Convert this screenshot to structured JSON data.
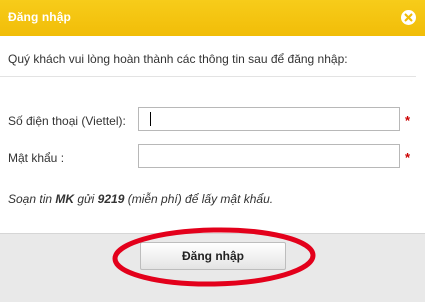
{
  "dialog": {
    "title": "Đăng nhập",
    "close_icon": "close-icon",
    "intro_text": "Quý khách vui lòng hoàn thành các thông tin sau để đăng nhập:",
    "fields": {
      "phone": {
        "label": "Số điện thoại (Viettel):",
        "value": "",
        "required_mark": "*"
      },
      "password": {
        "label": "Mật khẩu :",
        "value": "",
        "required_mark": "*"
      }
    },
    "hint": {
      "prefix": "Soạn tin ",
      "keyword": "MK",
      "middle": " gửi ",
      "number": "9219",
      "suffix": " (miễn phí) để lấy mật khẩu."
    },
    "submit_label": "Đăng nhập"
  },
  "colors": {
    "titlebar": "#f4c30f",
    "required": "#cc0000",
    "annotation": "#e3001b"
  }
}
